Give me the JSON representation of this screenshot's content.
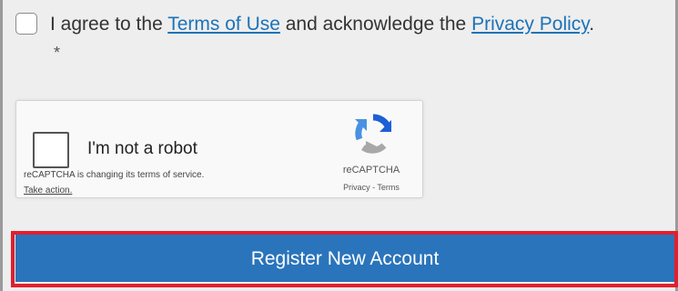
{
  "terms": {
    "prefix": "I agree to the ",
    "terms_link": "Terms of Use",
    "middle": " and acknowledge the ",
    "privacy_link": "Privacy Policy",
    "suffix": ".",
    "required_marker": "*"
  },
  "recaptcha": {
    "label": "I'm not a robot",
    "notice": "reCAPTCHA is changing its terms of service.",
    "action": "Take action.",
    "brand": "reCAPTCHA",
    "links": "Privacy - Terms",
    "logo_icon": "recaptcha-logo-icon"
  },
  "register": {
    "label": "Register New Account"
  },
  "colors": {
    "link": "#1c73b8",
    "button": "#2a74bb",
    "highlight": "#e0202e"
  }
}
